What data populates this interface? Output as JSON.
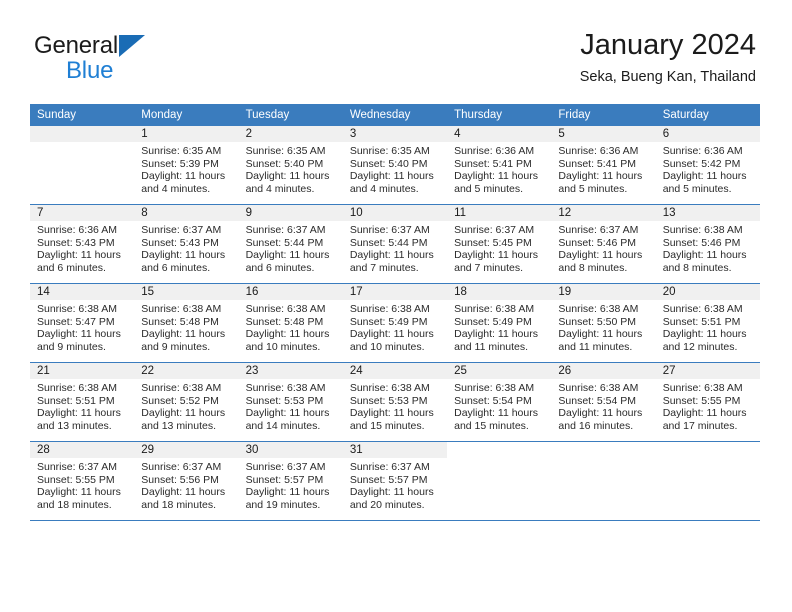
{
  "brand": {
    "name_part1": "General",
    "name_part2": "Blue",
    "logo_icon": "triangle-logo-icon",
    "colors": {
      "blue": "#1f7fd4",
      "triangle": "#1a6cb5",
      "dark": "#1b1b1b"
    }
  },
  "header": {
    "title": "January 2024",
    "subtitle": "Seka, Bueng Kan, Thailand"
  },
  "calendar": {
    "header_background": "#3a7cbe",
    "daynum_background": "#f0f0f0",
    "weekday_headers": [
      "Sunday",
      "Monday",
      "Tuesday",
      "Wednesday",
      "Thursday",
      "Friday",
      "Saturday"
    ],
    "weeks": [
      [
        {
          "day": "",
          "lines": []
        },
        {
          "day": "1",
          "lines": [
            "Sunrise: 6:35 AM",
            "Sunset: 5:39 PM",
            "Daylight: 11 hours",
            "and 4 minutes."
          ]
        },
        {
          "day": "2",
          "lines": [
            "Sunrise: 6:35 AM",
            "Sunset: 5:40 PM",
            "Daylight: 11 hours",
            "and 4 minutes."
          ]
        },
        {
          "day": "3",
          "lines": [
            "Sunrise: 6:35 AM",
            "Sunset: 5:40 PM",
            "Daylight: 11 hours",
            "and 4 minutes."
          ]
        },
        {
          "day": "4",
          "lines": [
            "Sunrise: 6:36 AM",
            "Sunset: 5:41 PM",
            "Daylight: 11 hours",
            "and 5 minutes."
          ]
        },
        {
          "day": "5",
          "lines": [
            "Sunrise: 6:36 AM",
            "Sunset: 5:41 PM",
            "Daylight: 11 hours",
            "and 5 minutes."
          ]
        },
        {
          "day": "6",
          "lines": [
            "Sunrise: 6:36 AM",
            "Sunset: 5:42 PM",
            "Daylight: 11 hours",
            "and 5 minutes."
          ]
        }
      ],
      [
        {
          "day": "7",
          "lines": [
            "Sunrise: 6:36 AM",
            "Sunset: 5:43 PM",
            "Daylight: 11 hours",
            "and 6 minutes."
          ]
        },
        {
          "day": "8",
          "lines": [
            "Sunrise: 6:37 AM",
            "Sunset: 5:43 PM",
            "Daylight: 11 hours",
            "and 6 minutes."
          ]
        },
        {
          "day": "9",
          "lines": [
            "Sunrise: 6:37 AM",
            "Sunset: 5:44 PM",
            "Daylight: 11 hours",
            "and 6 minutes."
          ]
        },
        {
          "day": "10",
          "lines": [
            "Sunrise: 6:37 AM",
            "Sunset: 5:44 PM",
            "Daylight: 11 hours",
            "and 7 minutes."
          ]
        },
        {
          "day": "11",
          "lines": [
            "Sunrise: 6:37 AM",
            "Sunset: 5:45 PM",
            "Daylight: 11 hours",
            "and 7 minutes."
          ]
        },
        {
          "day": "12",
          "lines": [
            "Sunrise: 6:37 AM",
            "Sunset: 5:46 PM",
            "Daylight: 11 hours",
            "and 8 minutes."
          ]
        },
        {
          "day": "13",
          "lines": [
            "Sunrise: 6:38 AM",
            "Sunset: 5:46 PM",
            "Daylight: 11 hours",
            "and 8 minutes."
          ]
        }
      ],
      [
        {
          "day": "14",
          "lines": [
            "Sunrise: 6:38 AM",
            "Sunset: 5:47 PM",
            "Daylight: 11 hours",
            "and 9 minutes."
          ]
        },
        {
          "day": "15",
          "lines": [
            "Sunrise: 6:38 AM",
            "Sunset: 5:48 PM",
            "Daylight: 11 hours",
            "and 9 minutes."
          ]
        },
        {
          "day": "16",
          "lines": [
            "Sunrise: 6:38 AM",
            "Sunset: 5:48 PM",
            "Daylight: 11 hours",
            "and 10 minutes."
          ]
        },
        {
          "day": "17",
          "lines": [
            "Sunrise: 6:38 AM",
            "Sunset: 5:49 PM",
            "Daylight: 11 hours",
            "and 10 minutes."
          ]
        },
        {
          "day": "18",
          "lines": [
            "Sunrise: 6:38 AM",
            "Sunset: 5:49 PM",
            "Daylight: 11 hours",
            "and 11 minutes."
          ]
        },
        {
          "day": "19",
          "lines": [
            "Sunrise: 6:38 AM",
            "Sunset: 5:50 PM",
            "Daylight: 11 hours",
            "and 11 minutes."
          ]
        },
        {
          "day": "20",
          "lines": [
            "Sunrise: 6:38 AM",
            "Sunset: 5:51 PM",
            "Daylight: 11 hours",
            "and 12 minutes."
          ]
        }
      ],
      [
        {
          "day": "21",
          "lines": [
            "Sunrise: 6:38 AM",
            "Sunset: 5:51 PM",
            "Daylight: 11 hours",
            "and 13 minutes."
          ]
        },
        {
          "day": "22",
          "lines": [
            "Sunrise: 6:38 AM",
            "Sunset: 5:52 PM",
            "Daylight: 11 hours",
            "and 13 minutes."
          ]
        },
        {
          "day": "23",
          "lines": [
            "Sunrise: 6:38 AM",
            "Sunset: 5:53 PM",
            "Daylight: 11 hours",
            "and 14 minutes."
          ]
        },
        {
          "day": "24",
          "lines": [
            "Sunrise: 6:38 AM",
            "Sunset: 5:53 PM",
            "Daylight: 11 hours",
            "and 15 minutes."
          ]
        },
        {
          "day": "25",
          "lines": [
            "Sunrise: 6:38 AM",
            "Sunset: 5:54 PM",
            "Daylight: 11 hours",
            "and 15 minutes."
          ]
        },
        {
          "day": "26",
          "lines": [
            "Sunrise: 6:38 AM",
            "Sunset: 5:54 PM",
            "Daylight: 11 hours",
            "and 16 minutes."
          ]
        },
        {
          "day": "27",
          "lines": [
            "Sunrise: 6:38 AM",
            "Sunset: 5:55 PM",
            "Daylight: 11 hours",
            "and 17 minutes."
          ]
        }
      ],
      [
        {
          "day": "28",
          "lines": [
            "Sunrise: 6:37 AM",
            "Sunset: 5:55 PM",
            "Daylight: 11 hours",
            "and 18 minutes."
          ]
        },
        {
          "day": "29",
          "lines": [
            "Sunrise: 6:37 AM",
            "Sunset: 5:56 PM",
            "Daylight: 11 hours",
            "and 18 minutes."
          ]
        },
        {
          "day": "30",
          "lines": [
            "Sunrise: 6:37 AM",
            "Sunset: 5:57 PM",
            "Daylight: 11 hours",
            "and 19 minutes."
          ]
        },
        {
          "day": "31",
          "lines": [
            "Sunrise: 6:37 AM",
            "Sunset: 5:57 PM",
            "Daylight: 11 hours",
            "and 20 minutes."
          ]
        },
        {
          "day": "",
          "lines": []
        },
        {
          "day": "",
          "lines": []
        },
        {
          "day": "",
          "lines": []
        }
      ]
    ]
  }
}
